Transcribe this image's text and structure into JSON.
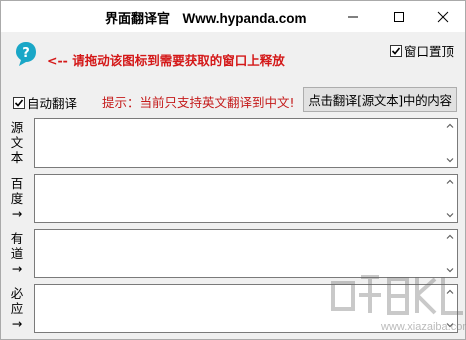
{
  "window": {
    "title_cn": "界面翻译官",
    "title_url": "Www.hypanda.com"
  },
  "drag": {
    "icon": "drag-target-icon",
    "text": "<-- 请拖动该图标到需要获取的窗口上释放"
  },
  "options": {
    "topmost_label": "窗口置顶",
    "topmost_checked": true,
    "auto_label": "自动翻译",
    "auto_checked": true
  },
  "hint": {
    "label": "提示：",
    "text": "当前只支持英文翻译到中文!"
  },
  "buttons": {
    "translate_source": "点击翻译[源文本]中的内容"
  },
  "panels": [
    {
      "label": "源文本",
      "value": ""
    },
    {
      "label": "百度→",
      "value": ""
    },
    {
      "label": "有道→",
      "value": ""
    },
    {
      "label": "必应→",
      "value": ""
    }
  ],
  "colors": {
    "accent_red": "#d41818",
    "icon_teal": "#1aa7c7"
  },
  "watermark": {
    "text": "www.xiazaiba.com"
  }
}
